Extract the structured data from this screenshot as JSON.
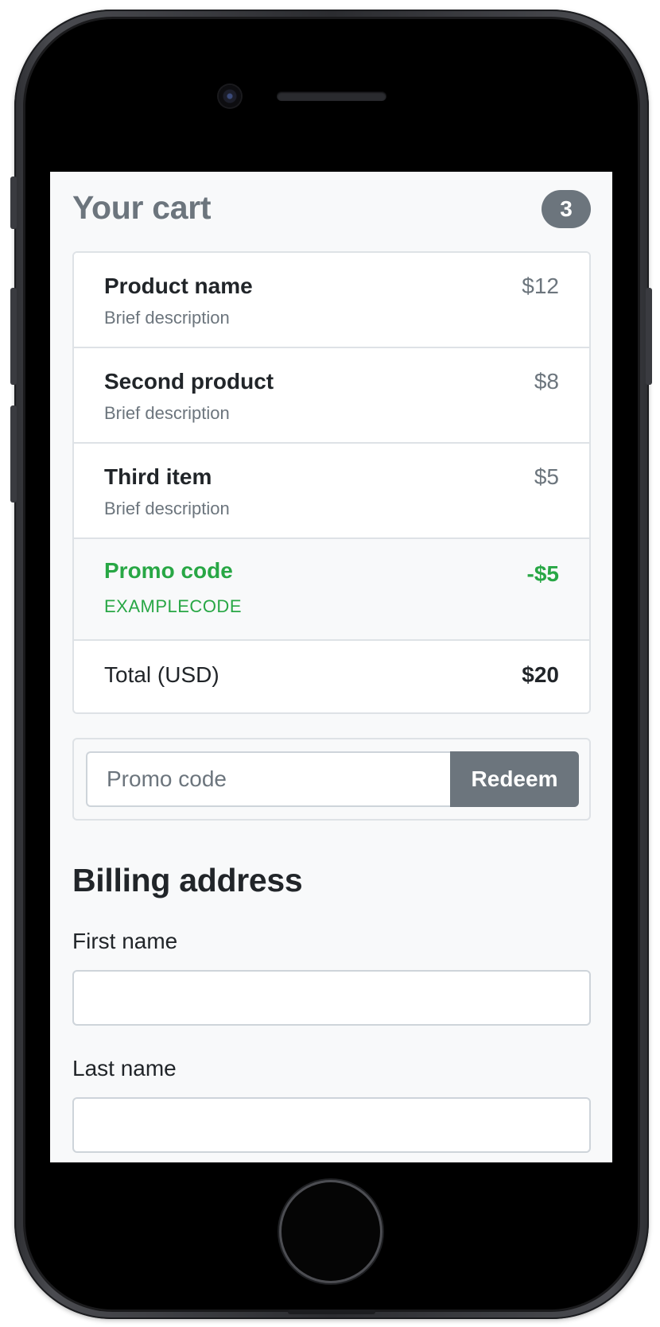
{
  "cart": {
    "title": "Your cart",
    "count": "3",
    "items": [
      {
        "name": "Product name",
        "description": "Brief description",
        "price": "$12"
      },
      {
        "name": "Second product",
        "description": "Brief description",
        "price": "$8"
      },
      {
        "name": "Third item",
        "description": "Brief description",
        "price": "$5"
      }
    ],
    "promo": {
      "label": "Promo code",
      "code": "EXAMPLECODE",
      "discount": "-$5"
    },
    "total": {
      "label": "Total (USD)",
      "amount": "$20"
    }
  },
  "promo_form": {
    "placeholder": "Promo code",
    "value": "",
    "button_label": "Redeem"
  },
  "billing": {
    "title": "Billing address",
    "first_name": {
      "label": "First name",
      "value": ""
    },
    "last_name": {
      "label": "Last name",
      "value": ""
    }
  },
  "colors": {
    "secondary": "#6c757d",
    "success": "#28a745",
    "text": "#212529",
    "border": "#dee2e6",
    "background": "#f8f9fa"
  }
}
